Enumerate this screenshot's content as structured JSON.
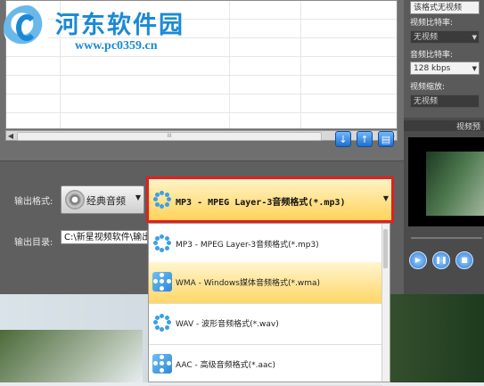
{
  "watermark": {
    "site_name": "河东软件园",
    "url": "www.pc0359.cn"
  },
  "main": {
    "output_format_label": "输出格式:",
    "output_dir_label": "输出目录:",
    "audio_type": {
      "label": "经典音频",
      "icon": "cd-disc-icon"
    },
    "format_selected": "MP3 - MPEG Layer-3音频格式(*.mp3)",
    "output_dir_value": "C:\\新星视频软件\\输出",
    "scroll_grip": "III",
    "toolbar_icons": [
      "arrow-down-icon",
      "arrow-up-icon",
      "edit-icon"
    ]
  },
  "dropdown": {
    "options": [
      {
        "label": "MP3 - MPEG Layer-3音频格式(*.mp3)",
        "selected": false
      },
      {
        "label": "WMA - Windows媒体音频格式(*.wma)",
        "selected": true
      },
      {
        "label": "WAV - 波形音频格式(*.wav)",
        "selected": false
      },
      {
        "label": "AAC - 高级音频格式(*.aac)",
        "selected": false
      }
    ]
  },
  "settings": {
    "top_partial_value": "该格式无视频",
    "video_bitrate_label": "视频比特率:",
    "video_bitrate_value": "无视频",
    "audio_bitrate_label": "音频比特率:",
    "audio_bitrate_value": "128 kbps",
    "video_scale_label": "视频缩放:",
    "video_scale_value": "无视频"
  },
  "preview": {
    "title": "视频预",
    "buttons": [
      "play-icon",
      "pause-icon",
      "stop-icon"
    ]
  },
  "colors": {
    "highlight_border": "#e02020",
    "selected_bg": "#ffd766",
    "watermark": "#1a89d6"
  }
}
